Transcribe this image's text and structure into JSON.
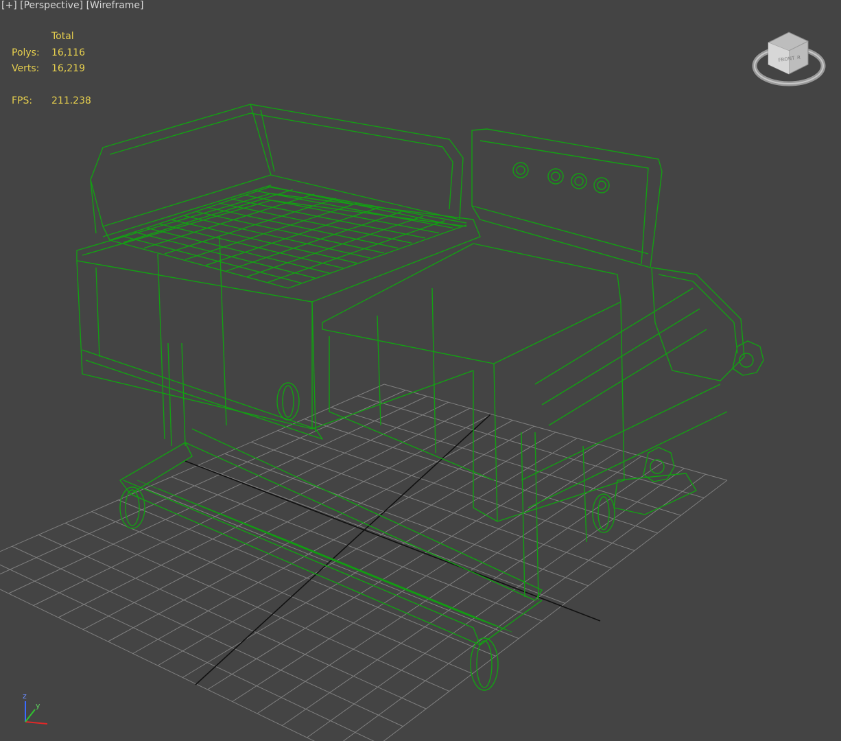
{
  "viewport": {
    "label_plus": "[+]",
    "label_view": "[Perspective]",
    "label_mode": "[Wireframe]"
  },
  "stats": {
    "header": "Total",
    "polys_label": "Polys:",
    "polys_value": "16,116",
    "verts_label": "Verts:",
    "verts_value": "16,219",
    "fps_label": "FPS:",
    "fps_value": "211.238"
  },
  "viewcube": {
    "face_label": "FRONT",
    "right_label": "R"
  },
  "axis_tripod": {
    "z_label": "z",
    "y_label": "y",
    "x_label": "x"
  },
  "colors": {
    "background": "#444444",
    "grid": "#8a8a8a",
    "wire": "#13a013",
    "stats_text": "#e6cf4e"
  },
  "icons": [
    "viewcube-icon",
    "axis-tripod-icon"
  ]
}
